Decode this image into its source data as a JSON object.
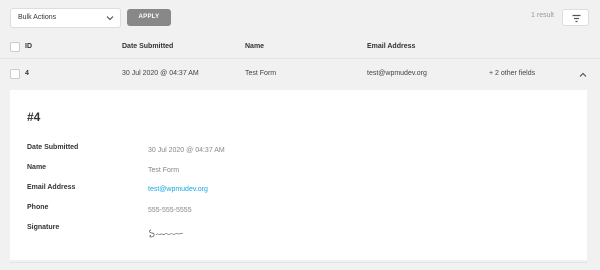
{
  "toolbar": {
    "bulk_actions_label": "Bulk Actions",
    "apply_label": "APPLY",
    "result_count": "1 result"
  },
  "table": {
    "headers": {
      "id": "ID",
      "date": "Date Submitted",
      "name": "Name",
      "email": "Email Address"
    },
    "rows": [
      {
        "id": "4",
        "date": "30 Jul 2020 @ 04:37 AM",
        "name": "Test Form",
        "email": "test@wpmudev.org",
        "other": "+ 2 other fields"
      }
    ]
  },
  "detail": {
    "title": "#4",
    "fields": [
      {
        "label": "Date Submitted",
        "value": "30 Jul 2020 @ 04:37 AM"
      },
      {
        "label": "Name",
        "value": "Test Form"
      },
      {
        "label": "Email Address",
        "value": "test@wpmudev.org"
      },
      {
        "label": "Phone",
        "value": "555-555-5555"
      },
      {
        "label": "Signature",
        "value": ""
      }
    ]
  },
  "colors": {
    "link": "#17a8e3",
    "apply_button": "#888888",
    "background": "#f1f1f1"
  },
  "icons": {
    "bulk_dropdown": "chevron-down-icon",
    "filter": "filter-icon",
    "row_toggle": "chevron-up-icon"
  }
}
